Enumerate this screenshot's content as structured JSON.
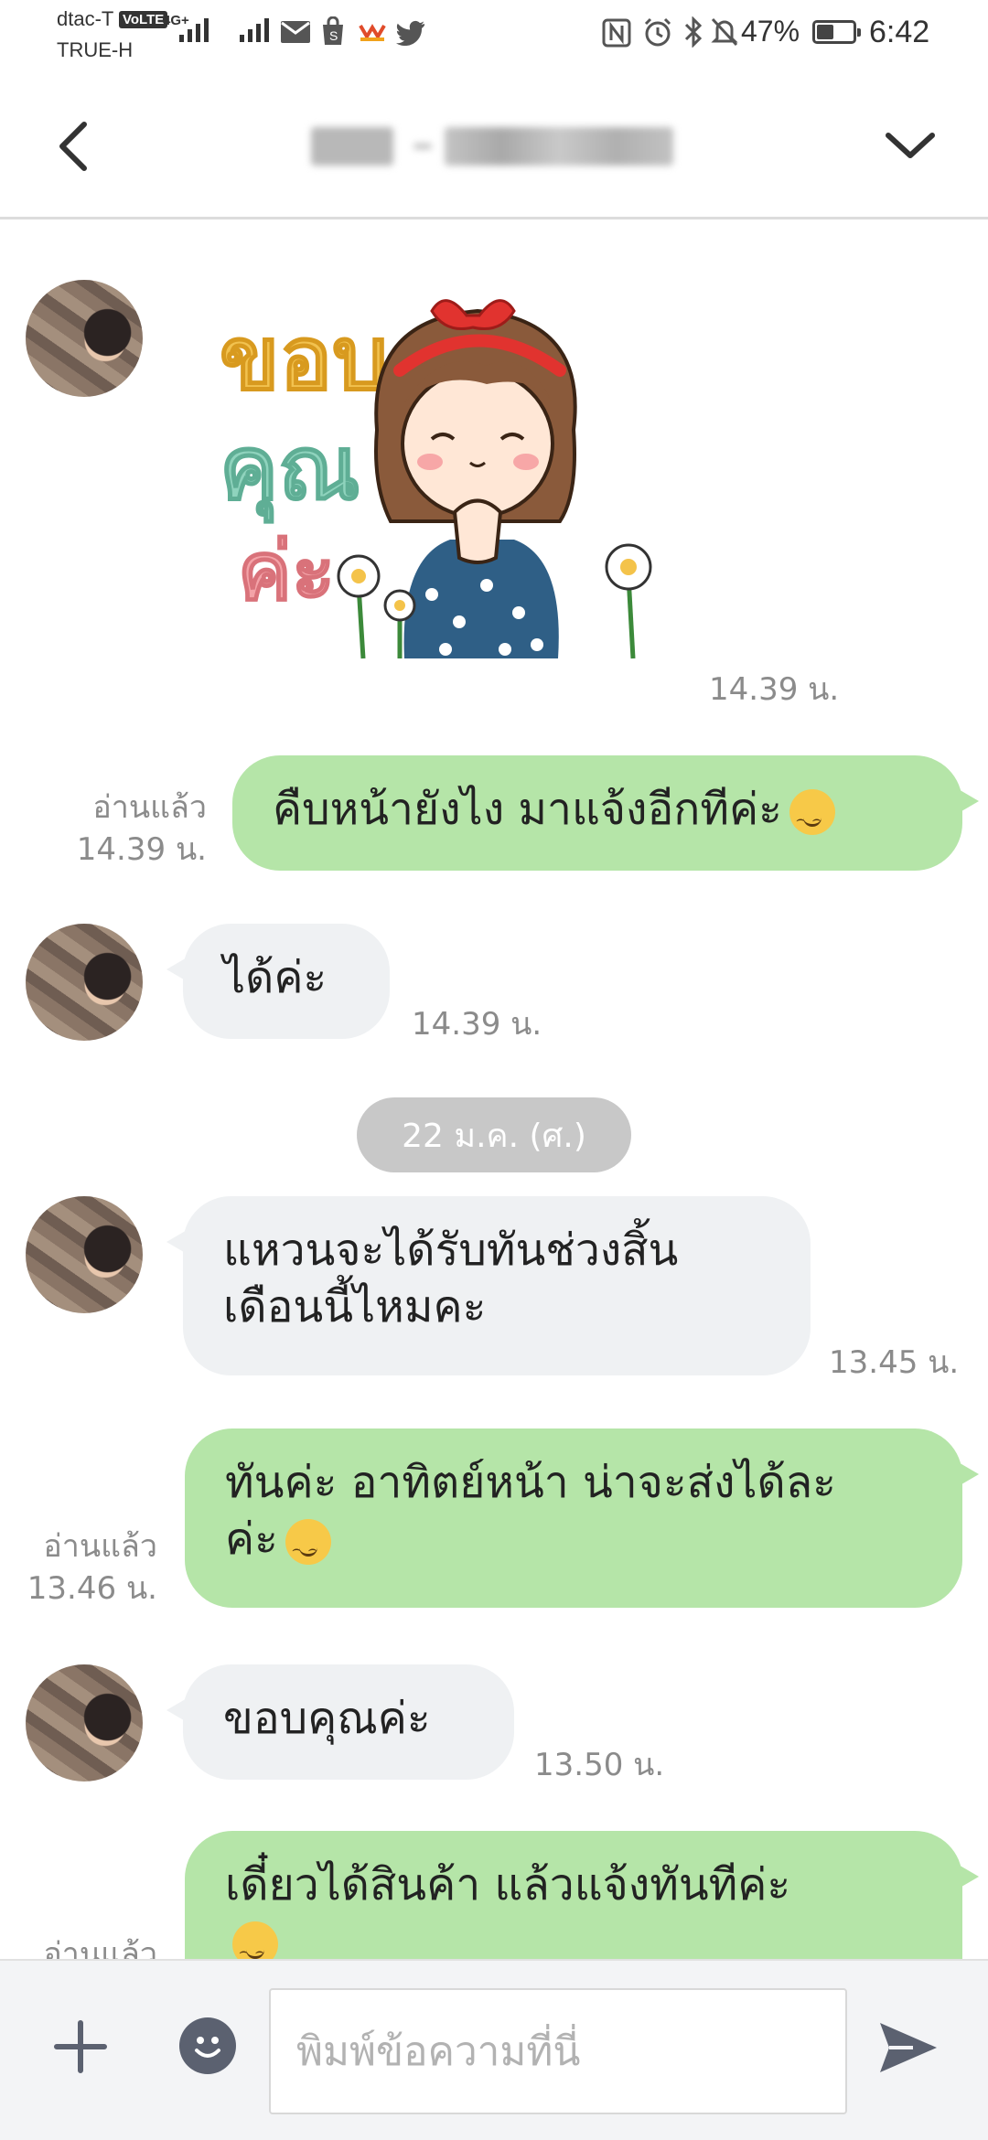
{
  "status_bar": {
    "carrier_1": "dtac-T",
    "carrier_2": "TRUE-H",
    "volte": "VoLTE",
    "network": "4G+",
    "battery_percent": "47%",
    "battery_level": 0.47,
    "time": "6:42",
    "icons": [
      "signal-icon",
      "signal-icon",
      "mail-icon",
      "shopping-bag-icon",
      "app-notification-icon",
      "twitter-icon",
      "nfc-icon",
      "alarm-icon",
      "bluetooth-icon",
      "silent-icon",
      "battery-icon"
    ]
  },
  "header": {
    "back_icon": "chevron-left-icon",
    "menu_icon": "chevron-down-icon",
    "title_blurred": true
  },
  "messages": [
    {
      "type": "sticker",
      "direction": "in",
      "sticker_text": [
        "ขอบ",
        "คุณ",
        "ค่ะ"
      ],
      "time": "14.39 น."
    },
    {
      "type": "text",
      "direction": "out",
      "text": "คืบหน้ายังไง มาแจ้งอีกทีค่ะ",
      "emoji": "smiling-face-icon",
      "read": "อ่านแล้ว",
      "time": "14.39 น."
    },
    {
      "type": "text",
      "direction": "in",
      "text": "ได้ค่ะ",
      "time": "14.39 น."
    },
    {
      "type": "text",
      "direction": "in",
      "lines": [
        "แหวนจะได้รับทันช่วงสิ้น",
        "เดือนนี้ไหมคะ"
      ],
      "time": "13.45 น."
    },
    {
      "type": "text",
      "direction": "out",
      "lines": [
        "ทันค่ะ อาทิตย์หน้า น่าจะส่งได้ละ",
        "ค่ะ"
      ],
      "emoji": "smiling-face-icon",
      "read": "อ่านแล้ว",
      "time": "13.46 น."
    },
    {
      "type": "text",
      "direction": "in",
      "text": "ขอบคุณค่ะ",
      "time": "13.50 น."
    },
    {
      "type": "text",
      "direction": "out",
      "text": "เดี๋ยวได้สินค้า แล้วแจ้งทันทีค่ะ",
      "read": "อ่านแล้ว"
    }
  ],
  "date_separator": "22 ม.ค. (ศ.)",
  "input_bar": {
    "placeholder": "พิมพ์ข้อความที่นี่",
    "value": "",
    "plus_icon": "plus-icon",
    "emoji_icon": "emoji-icon",
    "send_icon": "send-icon"
  }
}
